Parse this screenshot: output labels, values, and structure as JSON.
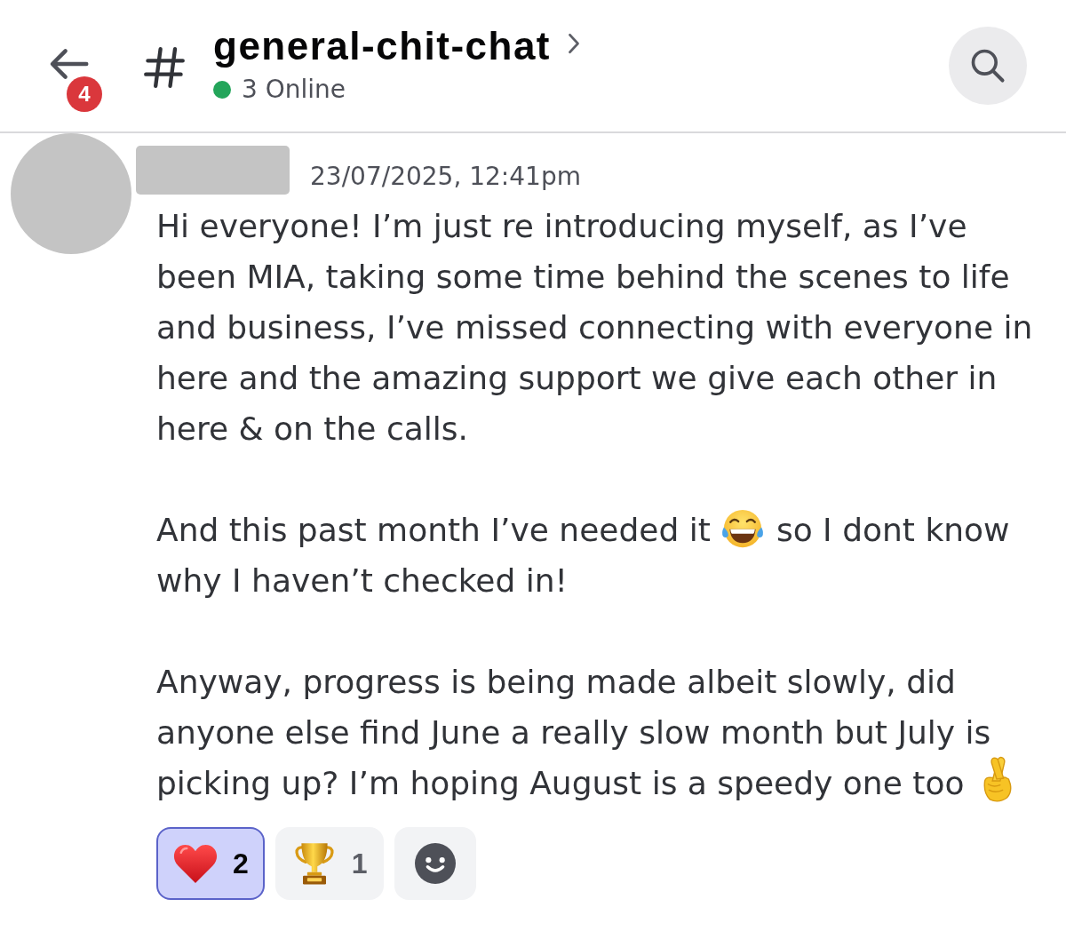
{
  "header": {
    "unread_badge": "4",
    "channel_name": "general-chit-chat",
    "online_count": "3 Online"
  },
  "message": {
    "timestamp": "23/07/2025, 12:41pm",
    "paragraphs": [
      {
        "rows": [
          [
            {
              "kind": "text",
              "text": "Hi everyone! I’m just re introducing myself, as I’ve been MIA, taking some time behind the scenes to life and business, I’ve missed connecting with everyone in here and the amazing support we give each other in here & on the calls."
            }
          ]
        ]
      },
      {
        "rows": [
          [
            {
              "kind": "text",
              "text": "And this past month I’ve needed it"
            },
            {
              "kind": "laugh"
            },
            {
              "kind": "text",
              "text": "so I dont know"
            }
          ],
          [
            {
              "kind": "text",
              "text": "why I haven’t checked in!"
            }
          ]
        ]
      },
      {
        "rows": [
          [
            {
              "kind": "text",
              "text": "Anyway, progress is being made albeit slowly, did anyone else find June a really slow month but July is"
            }
          ],
          [
            {
              "kind": "text",
              "text": "picking up? I’m hoping August is a speedy one too"
            },
            {
              "kind": "fingers"
            }
          ]
        ]
      }
    ],
    "reactions": [
      {
        "kind": "heart",
        "count": "2",
        "selected": true
      },
      {
        "kind": "trophy",
        "count": "1",
        "selected": false
      }
    ]
  }
}
